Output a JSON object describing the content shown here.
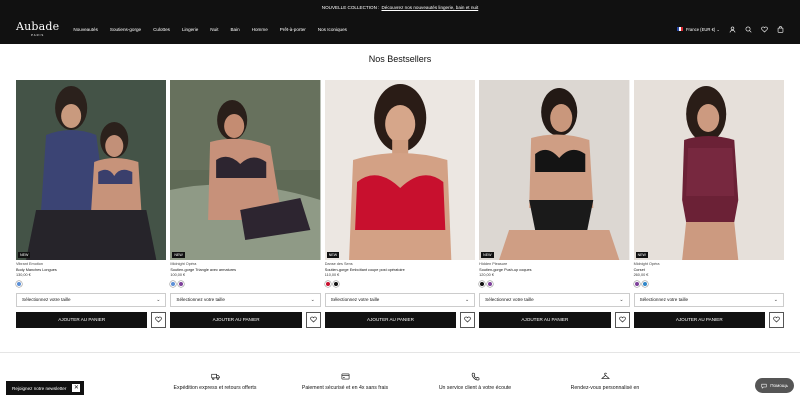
{
  "announcement": {
    "text": "NOUVELLE COLLECTION :",
    "link": "Découvrez nos nouveautés lingerie, bain et nuit"
  },
  "header": {
    "logo": "Aubade",
    "logo_sub": "PARIS",
    "nav": [
      "Nouveautés",
      "Soutiens-gorge",
      "Culottes",
      "Lingerie",
      "Nuit",
      "Bain",
      "Homme",
      "Prêt-à-porter",
      "Nos Iconiques"
    ],
    "locale": "France (EUR €)"
  },
  "section_title": "Nos Bestsellers",
  "products": [
    {
      "badge": "NEW",
      "collection": "Vibrant Emotion",
      "name": "Body Manches Longues",
      "price": "130,00 €",
      "swatches": [
        "#5b8fd6"
      ],
      "size_placeholder": "Sélectionnez votre taille",
      "add_label": "AJOUTER AU PANIER"
    },
    {
      "badge": "NEW",
      "collection": "Midnight Opéra",
      "name": "Soutien-gorge Triangle avec armatures",
      "price": "100,00 €",
      "swatches": [
        "#5b8fd6",
        "#7d3f9a"
      ],
      "size_placeholder": "Sélectionnez votre taille",
      "add_label": "AJOUTER AU PANIER"
    },
    {
      "badge": "NEW",
      "collection": "Danse des Sens",
      "name": "Soutien-gorge Emboîtant coupe post opératoire",
      "price": "110,00 €",
      "swatches": [
        "#c8102e",
        "#111111"
      ],
      "size_placeholder": "Sélectionnez votre taille",
      "add_label": "AJOUTER AU PANIER"
    },
    {
      "badge": "NEW",
      "collection": "Hidden Pleasure",
      "name": "Soutien-gorge Push-up coques",
      "price": "120,00 €",
      "swatches": [
        "#111111",
        "#7d3f9a"
      ],
      "size_placeholder": "Sélectionnez votre taille",
      "add_label": "AJOUTER AU PANIER"
    },
    {
      "badge": "NEW",
      "collection": "Midnight Opéra",
      "name": "Corset",
      "price": "260,00 €",
      "swatches": [
        "#7d3f9a",
        "#2f86c8"
      ],
      "size_placeholder": "Sélectionnez votre taille",
      "add_label": "AJOUTER AU PANIER"
    }
  ],
  "features": [
    {
      "icon": "truck-icon",
      "text": "Expédition express et retours offerts"
    },
    {
      "icon": "card-icon",
      "text": "Paiement sécurisé et en 4x sans frais"
    },
    {
      "icon": "phone-icon",
      "text": "Un service client à votre écoute"
    },
    {
      "icon": "hanger-icon",
      "text": "Rendez-vous personnalisé en"
    }
  ],
  "newsletter": {
    "label": "Rejoignez notre newsletter",
    "close": "✕"
  },
  "help": {
    "label": "Помощь"
  }
}
